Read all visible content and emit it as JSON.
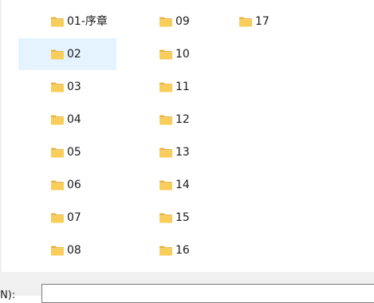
{
  "folders": [
    {
      "label": "01-序章",
      "selected": false
    },
    {
      "label": "02",
      "selected": true
    },
    {
      "label": "03",
      "selected": false
    },
    {
      "label": "04",
      "selected": false
    },
    {
      "label": "05",
      "selected": false
    },
    {
      "label": "06",
      "selected": false
    },
    {
      "label": "07",
      "selected": false
    },
    {
      "label": "08",
      "selected": false
    },
    {
      "label": "09",
      "selected": false
    },
    {
      "label": "10",
      "selected": false
    },
    {
      "label": "11",
      "selected": false
    },
    {
      "label": "12",
      "selected": false
    },
    {
      "label": "13",
      "selected": false
    },
    {
      "label": "14",
      "selected": false
    },
    {
      "label": "15",
      "selected": false
    },
    {
      "label": "16",
      "selected": false
    },
    {
      "label": "17",
      "selected": false
    }
  ],
  "footer": {
    "filename_label": "名(N):",
    "filename_value": ""
  },
  "colors": {
    "selection": "#e5f3ff",
    "folder_body": "#f8cd5a",
    "folder_tab": "#e9b43f"
  }
}
